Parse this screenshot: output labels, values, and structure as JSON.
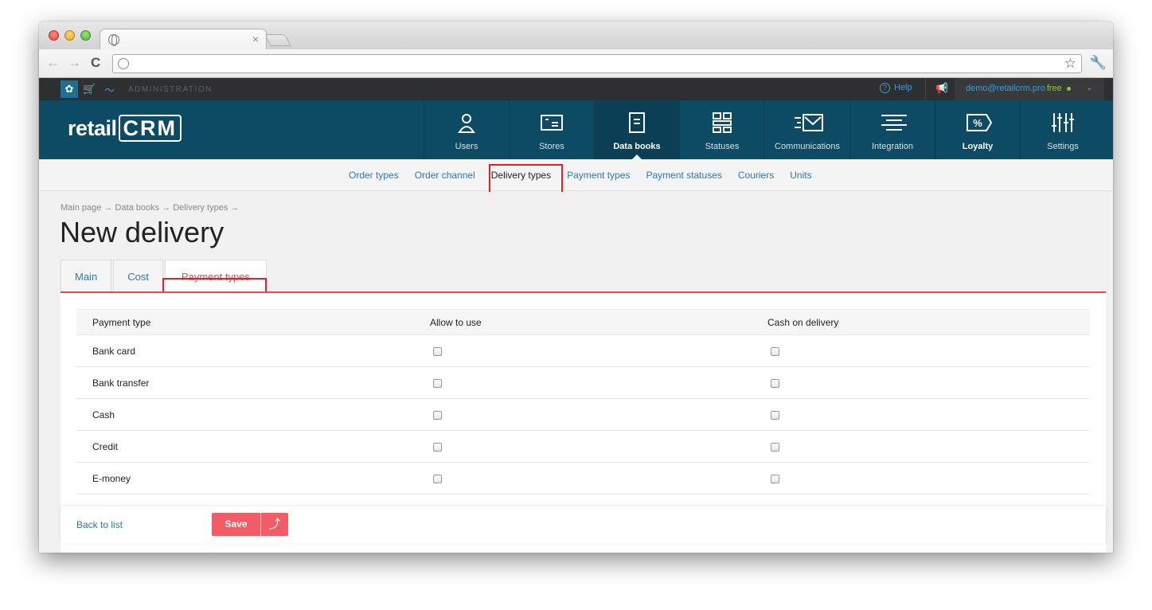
{
  "browser": {
    "tab_close": "×",
    "nav_back": "←",
    "nav_forward": "→",
    "reload": "C",
    "star": "☆",
    "wrench": "🔧"
  },
  "adminbar": {
    "label": "ADMINISTRATION",
    "help": "Help",
    "help_icon": "?",
    "user_email": "demo@retailcrm.pro",
    "plan": "free",
    "gear_icon": "✿",
    "cart_icon": "🛒",
    "chart_icon": "〜",
    "notify_icon": "📢",
    "chevron_icon": "⌄"
  },
  "header": {
    "logo_prefix": "retail",
    "logo_suffix": "CRM",
    "nav": [
      {
        "label": "Users",
        "icon": "user-icon"
      },
      {
        "label": "Stores",
        "icon": "store-icon"
      },
      {
        "label": "Data books",
        "icon": "book-icon"
      },
      {
        "label": "Statuses",
        "icon": "statuses-icon"
      },
      {
        "label": "Communications",
        "icon": "mail-icon"
      },
      {
        "label": "Integration",
        "icon": "integration-icon"
      },
      {
        "label": "Loyalty",
        "icon": "percent-tag-icon"
      },
      {
        "label": "Settings",
        "icon": "sliders-icon"
      }
    ]
  },
  "subnav": {
    "items": [
      "Order types",
      "Order channel",
      "Delivery types",
      "Payment types",
      "Payment statuses",
      "Couriers",
      "Units"
    ],
    "current": "Delivery types"
  },
  "page": {
    "breadcrumb": "Main page → Data books → Delivery types →",
    "title": "New delivery",
    "tabs": [
      "Main",
      "Cost",
      "Payment types"
    ],
    "active_tab": "Payment types"
  },
  "table": {
    "headers": [
      "Payment type",
      "Allow to use",
      "Cash on delivery"
    ],
    "rows": [
      {
        "name": "Bank card",
        "allow": false,
        "cod": false
      },
      {
        "name": "Bank transfer",
        "allow": false,
        "cod": false
      },
      {
        "name": "Cash",
        "allow": false,
        "cod": false
      },
      {
        "name": "Credit",
        "allow": false,
        "cod": false
      },
      {
        "name": "E-money",
        "allow": false,
        "cod": false
      }
    ]
  },
  "footer": {
    "back_label": "Back to list",
    "save_label": "Save",
    "save_arrow": "⤴"
  },
  "colors": {
    "header_bg": "#0d4a63",
    "accent_red": "#e94b53",
    "link_blue": "#2a7ab0",
    "highlight": "#e0202b"
  }
}
